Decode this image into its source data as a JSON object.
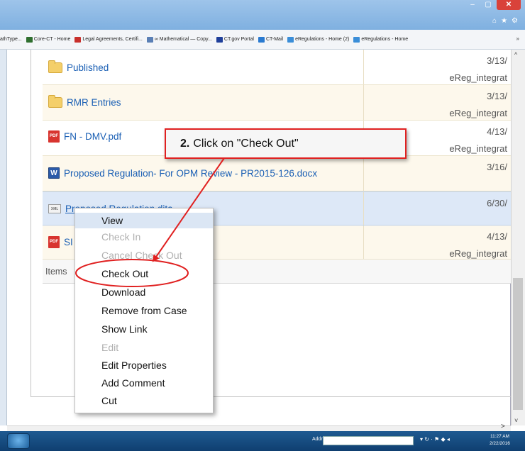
{
  "window": {
    "controls": [
      "–",
      "▢",
      "✕"
    ],
    "title_icons": [
      "⌂",
      "★",
      "⚙"
    ]
  },
  "favorites_bar": {
    "items": [
      {
        "label": "athType...",
        "icon_color": ""
      },
      {
        "label": "Core-CT - Home",
        "icon_color": "#2f6f2f"
      },
      {
        "label": "Legal Agreements, Certifi...",
        "icon_color": "#c8302c"
      },
      {
        "label": "∞ Mathematical — Copy...",
        "icon_color": "#5a7fb5"
      },
      {
        "label": "CT.gov Portal",
        "icon_color": "#1f3f9a"
      },
      {
        "label": "CT-Mail",
        "icon_color": "#2a7ad0"
      },
      {
        "label": "eRegulations - Home (2)",
        "icon_color": "#3b8ed8"
      },
      {
        "label": "eRegulations - Home",
        "icon_color": "#3b8ed8"
      }
    ],
    "overflow": "»"
  },
  "file_list": {
    "rows": [
      {
        "name": "Published",
        "icon": "folder-icon",
        "date": "3/13/",
        "author": "eReg_integrat"
      },
      {
        "name": "RMR Entries",
        "icon": "folder-icon",
        "date": "3/13/",
        "author": "eReg_integrat"
      },
      {
        "name": "FN - DMV.pdf",
        "icon": "pdf-icon",
        "date": "4/13/",
        "author": "eReg_integrat"
      },
      {
        "name": "Proposed Regulation- For OPM Review - PR2015-126.docx",
        "icon": "word-doc-icon",
        "date": "3/16/",
        "author": ""
      },
      {
        "name": "Proposed Regulation.dita",
        "icon": "xml-file-icon",
        "date": "6/30/",
        "author": ""
      },
      {
        "name": "SI",
        "icon": "pdf-icon",
        "date": "4/13/",
        "author": "eReg_integrat"
      }
    ],
    "items_label": "Items"
  },
  "icons": {
    "pdf": "PDF",
    "doc": "W",
    "xml": "XML"
  },
  "callout": {
    "step": "2.",
    "text": "Click on \"Check Out\""
  },
  "context_menu": {
    "items": [
      {
        "label": "View",
        "enabled": true
      },
      {
        "label": "Check In",
        "enabled": false
      },
      {
        "label": "Cancel Check Out",
        "enabled": false
      },
      {
        "label": "Check Out",
        "enabled": true
      },
      {
        "label": "Download",
        "enabled": true
      },
      {
        "label": "Remove from Case",
        "enabled": true
      },
      {
        "label": "Show Link",
        "enabled": true
      },
      {
        "label": "Edit",
        "enabled": false
      },
      {
        "label": "Edit Properties",
        "enabled": true
      },
      {
        "label": "Add Comment",
        "enabled": true
      },
      {
        "label": "Cut",
        "enabled": true
      }
    ],
    "highlighted": "Check Out"
  },
  "scrollbars": {
    "up": "^",
    "down": "˅",
    "right": ">"
  },
  "taskbar": {
    "address_label": "Address",
    "address_value": "",
    "tray_icons": "▾ ↻ · ⚑ ◆ ◂",
    "time": "11:27 AM",
    "date": "2/22/2016"
  },
  "colors": {
    "annotation_red": "#e02020",
    "link_blue": "#1a5fb4",
    "selected_row": "#dde8f7",
    "row_tint": "#fdf8ec"
  }
}
